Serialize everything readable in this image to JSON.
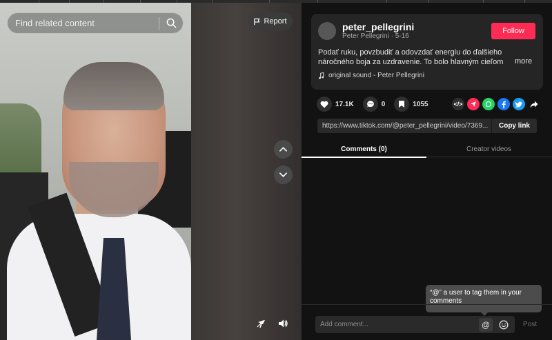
{
  "search": {
    "placeholder": "Find related content"
  },
  "video": {
    "report_label": "Report"
  },
  "post": {
    "username": "peter_pellegrini",
    "display_name": "Peter Pellegrini",
    "separator": " · ",
    "date": "5-16",
    "follow_label": "Follow",
    "description": "Podať ruku, povzbudiť a odovzdať energiu do ďalšieho náročného boja za uzdravenie. To bolo hlavným cieľom",
    "more_label": "more",
    "sound": "original sound - Peter Pellegrini"
  },
  "actions": {
    "likes": "17.1K",
    "comments": "0",
    "saves": "1055"
  },
  "share": {
    "embed_icon": "</>",
    "icons": [
      "send-icon",
      "whatsapp-icon",
      "facebook-icon",
      "twitter-icon",
      "share-arrow-icon"
    ],
    "colors": {
      "send": "#fe2c55",
      "whatsapp": "#25d366",
      "facebook": "#1877f2",
      "twitter": "#1d9bf0"
    }
  },
  "link": {
    "url": "https://www.tiktok.com/@peter_pellegrini/video/7369...",
    "copy_label": "Copy link"
  },
  "tabs": {
    "comments": "Comments (0)",
    "creator": "Creator videos"
  },
  "tooltip": {
    "text": "“@” a user to tag them in your comments"
  },
  "comment": {
    "placeholder": "Add comment...",
    "at_symbol": "@",
    "post_label": "Post"
  },
  "colors": {
    "accent": "#fe2c55",
    "panel_bg": "#121212",
    "card_bg": "#252525"
  }
}
